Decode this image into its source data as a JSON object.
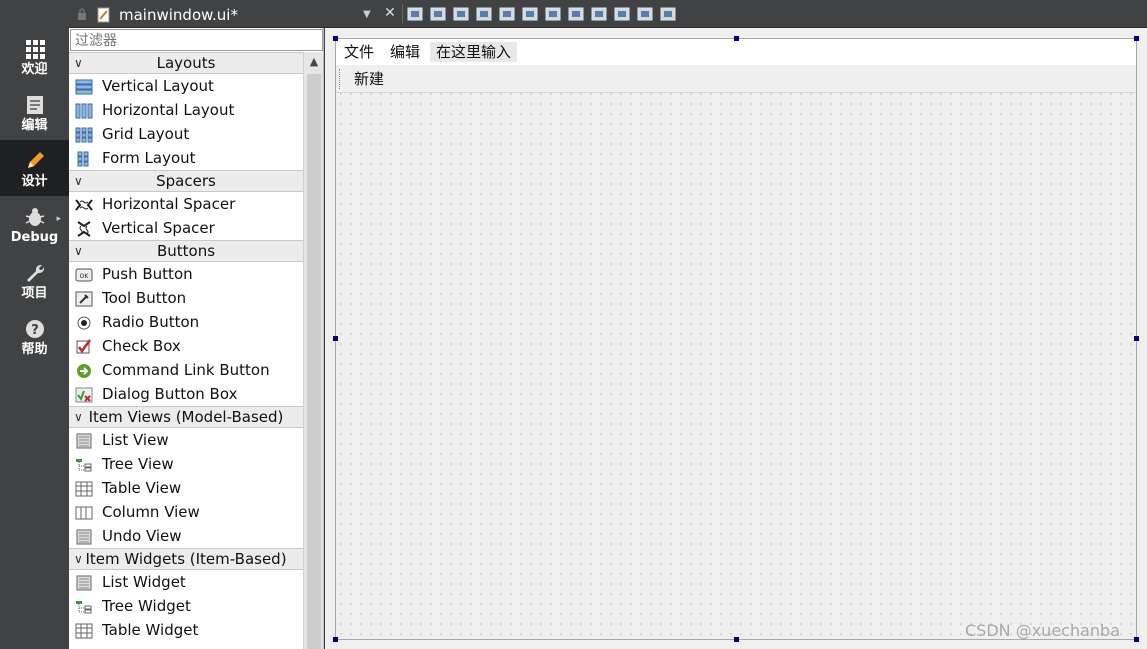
{
  "modebar": {
    "items": [
      {
        "label": "欢迎",
        "icon": "grid-icon",
        "active": false
      },
      {
        "label": "编辑",
        "icon": "document-icon",
        "active": false
      },
      {
        "label": "设计",
        "icon": "pencil-icon",
        "active": true
      },
      {
        "label": "Debug",
        "icon": "bug-icon",
        "active": false
      },
      {
        "label": "项目",
        "icon": "wrench-icon",
        "active": false
      },
      {
        "label": "帮助",
        "icon": "help-icon",
        "active": false
      }
    ]
  },
  "topbar": {
    "file_name": "mainwindow.ui*",
    "dropdown_glyph": "▼",
    "close_glyph": "✕",
    "tools": [
      "edit-widgets-icon",
      "edit-signals-icon",
      "edit-buddies-icon",
      "edit-tab-order-icon",
      "layout-horizontal-icon",
      "layout-vertical-icon",
      "layout-h-splitter-icon",
      "layout-v-splitter-icon",
      "layout-form-icon",
      "layout-grid-icon",
      "break-layout-icon",
      "adjust-size-icon"
    ]
  },
  "widgetbox": {
    "filter_placeholder": "过滤器",
    "scroll_up": "▲",
    "categories": [
      {
        "title": "Layouts",
        "items": [
          {
            "label": "Vertical Layout",
            "icon": "vertical-layout-icon"
          },
          {
            "label": "Horizontal Layout",
            "icon": "horizontal-layout-icon"
          },
          {
            "label": "Grid Layout",
            "icon": "grid-layout-icon"
          },
          {
            "label": "Form Layout",
            "icon": "form-layout-icon"
          }
        ]
      },
      {
        "title": "Spacers",
        "items": [
          {
            "label": "Horizontal Spacer",
            "icon": "horizontal-spacer-icon"
          },
          {
            "label": "Vertical Spacer",
            "icon": "vertical-spacer-icon"
          }
        ]
      },
      {
        "title": "Buttons",
        "items": [
          {
            "label": "Push Button",
            "icon": "push-button-icon"
          },
          {
            "label": "Tool Button",
            "icon": "tool-button-icon"
          },
          {
            "label": "Radio Button",
            "icon": "radio-button-icon"
          },
          {
            "label": "Check Box",
            "icon": "check-box-icon"
          },
          {
            "label": "Command Link Button",
            "icon": "command-link-icon"
          },
          {
            "label": "Dialog Button Box",
            "icon": "dialog-button-box-icon"
          }
        ]
      },
      {
        "title": "Item Views (Model-Based)",
        "items": [
          {
            "label": "List View",
            "icon": "list-view-icon"
          },
          {
            "label": "Tree View",
            "icon": "tree-view-icon"
          },
          {
            "label": "Table View",
            "icon": "table-view-icon"
          },
          {
            "label": "Column View",
            "icon": "column-view-icon"
          },
          {
            "label": "Undo View",
            "icon": "undo-view-icon"
          }
        ]
      },
      {
        "title": "Item Widgets (Item-Based)",
        "items": [
          {
            "label": "List Widget",
            "icon": "list-widget-icon"
          },
          {
            "label": "Tree Widget",
            "icon": "tree-widget-icon"
          },
          {
            "label": "Table Widget",
            "icon": "table-widget-icon"
          }
        ]
      }
    ]
  },
  "form": {
    "menus": [
      "文件",
      "编辑"
    ],
    "menu_placeholder": "在这里输入",
    "toolbar_action": "新建"
  },
  "watermark": "CSDN @xuechanba"
}
